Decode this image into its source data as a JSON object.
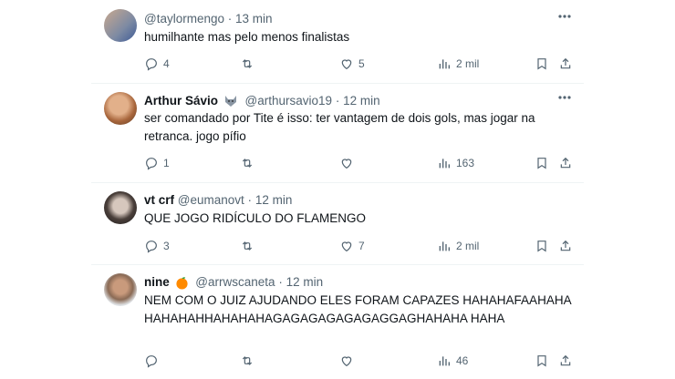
{
  "colors": {
    "text": "#0f1419",
    "muted": "#536471",
    "divider": "#eff3f4",
    "orange": "#ff8a00"
  },
  "replies": [
    {
      "name": "",
      "handle": "@taylormengo",
      "time": "13 min",
      "text": "humilhante mas pelo menos finalistas",
      "counts": {
        "reply": "4",
        "retweet": "",
        "like": "5",
        "views": "2 mil"
      }
    },
    {
      "name": "Arthur Sávio",
      "handle": "@arthursavio19",
      "time": "12 min",
      "text": "ser comandado por Tite é isso: ter vantagem de dois gols, mas jogar na retranca. jogo pífio",
      "counts": {
        "reply": "1",
        "retweet": "",
        "like": "",
        "views": "163"
      }
    },
    {
      "name": "vt crf",
      "handle": "@eumanovt",
      "time": "12 min",
      "text": "QUE JOGO RIDÍCULO DO FLAMENGO",
      "counts": {
        "reply": "3",
        "retweet": "",
        "like": "7",
        "views": "2 mil"
      }
    },
    {
      "name": "nine",
      "handle": "@arrwscaneta",
      "time": "12 min",
      "text": "NEM COM O JUIZ AJUDANDO ELES FORAM CAPAZES HAHAHAFAAHAHAHAHAHAHHAHAHAHAGAGAGAGAGAGAGGAGHAHAHA HAHA",
      "counts": {
        "reply": "",
        "retweet": "",
        "like": "",
        "views": "46"
      }
    }
  ],
  "separator": "·",
  "icons": {
    "reply": "reply-icon",
    "retweet": "retweet-icon",
    "like": "heart-icon",
    "views": "views-icon",
    "bookmark": "bookmark-icon",
    "share": "share-icon",
    "more": "more-icon"
  }
}
